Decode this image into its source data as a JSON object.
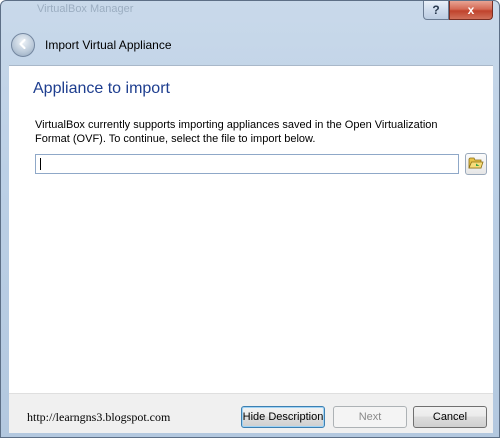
{
  "window": {
    "faded_title": "VirtualBox Manager",
    "help_glyph": "?",
    "close_glyph": "x"
  },
  "header": {
    "title": "Import Virtual Appliance",
    "back_icon": "back-arrow-icon"
  },
  "main": {
    "page_title": "Appliance to import",
    "description": "VirtualBox currently supports importing appliances saved in the Open Virtualization Format (OVF). To continue, select the file to import below.",
    "file_input": {
      "value": "",
      "placeholder": ""
    },
    "browse_icon": "folder-open-icon"
  },
  "footer": {
    "watermark": "http://learngns3.blogspot.com",
    "hide_description_label": "Hide Description",
    "next_label": "Next",
    "cancel_label": "Cancel"
  },
  "colors": {
    "title_blue": "#1e3e8f",
    "frame": "#bcd0e6",
    "close_red": "#c0432c"
  }
}
